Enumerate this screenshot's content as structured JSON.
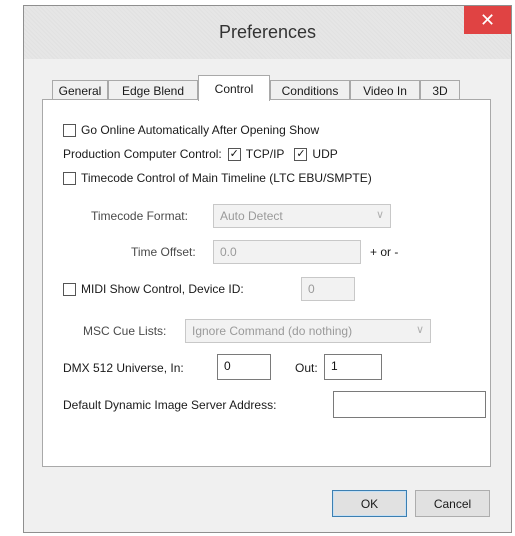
{
  "window": {
    "title": "Preferences",
    "close_glyph": "✕"
  },
  "tabs": [
    {
      "label": "General"
    },
    {
      "label": "Edge Blend"
    },
    {
      "label": "Control"
    },
    {
      "label": "Conditions"
    },
    {
      "label": "Video In"
    },
    {
      "label": "3D"
    }
  ],
  "control": {
    "go_online": {
      "label": "Go Online Automatically After Opening Show",
      "checked": false
    },
    "production_control": {
      "label": "Production Computer Control:",
      "tcp": {
        "label": "TCP/IP",
        "checked": true
      },
      "udp": {
        "label": "UDP",
        "checked": true
      }
    },
    "timecode_control": {
      "label": "Timecode Control of Main Timeline (LTC EBU/SMPTE)",
      "checked": false
    },
    "timecode_format": {
      "label": "Timecode Format:",
      "value": "Auto Detect"
    },
    "time_offset": {
      "label": "Time Offset:",
      "value": "0.0",
      "suffix": "+ or -"
    },
    "midi": {
      "label": "MIDI Show Control, Device ID:",
      "checked": false,
      "value": "0"
    },
    "msc_cue_lists": {
      "label": "MSC Cue Lists:",
      "value": "Ignore Command (do nothing)"
    },
    "dmx": {
      "label": "DMX 512 Universe, In:",
      "in_value": "0",
      "out_label": "Out:",
      "out_value": "1"
    },
    "image_server": {
      "label": "Default Dynamic Image Server Address:",
      "value": ""
    }
  },
  "buttons": {
    "ok": "OK",
    "cancel": "Cancel"
  },
  "icons": {
    "check": "✓",
    "dropdown": "chevron-down-icon",
    "close": "close-icon"
  }
}
